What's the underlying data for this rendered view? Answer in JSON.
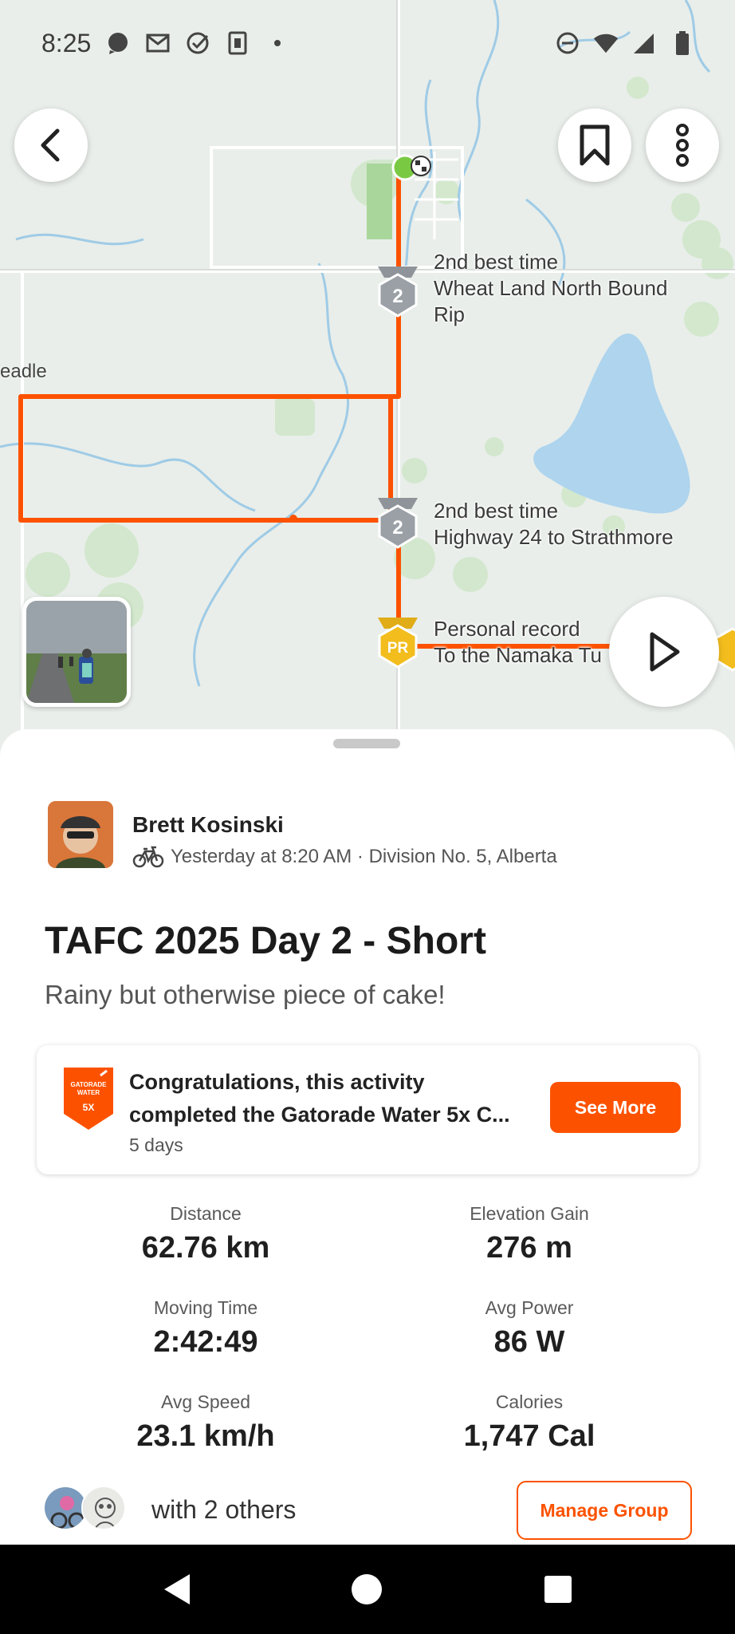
{
  "status_bar": {
    "time": "8:25",
    "icons_left": [
      "chat-bubble-icon",
      "mail-icon",
      "check-circle-icon",
      "notification-icon",
      "dot-icon"
    ],
    "icons_right": [
      "do-not-disturb-icon",
      "wifi-icon",
      "signal-icon",
      "battery-icon"
    ]
  },
  "map": {
    "place_label": "eadle",
    "segments": [
      {
        "achievement": "2nd best time",
        "name_line1": "Wheat Land North Bound",
        "name_line2": "Rip",
        "medal": "2"
      },
      {
        "achievement": "2nd best time",
        "name_line1": "Highway 24 to Strathmore",
        "name_line2": "",
        "medal": "2"
      },
      {
        "achievement": "Personal record",
        "name_line1": "To the Namaka Tu",
        "name_line2": "",
        "medal": "PR"
      }
    ],
    "colors": {
      "route": "#fc5200",
      "start": "#7ac943",
      "water": "#aed4ee",
      "field": "#c8e3c2"
    }
  },
  "athlete": {
    "name": "Brett Kosinski",
    "meta": "Yesterday at 8:20 AM · Division No. 5, Alberta",
    "sport_icon": "bike-icon"
  },
  "activity": {
    "title": "TAFC 2025 Day 2 - Short",
    "description": "Rainy but otherwise piece of cake!"
  },
  "challenge": {
    "line1": "Congratulations, this activity",
    "line2": "completed the Gatorade Water 5x C...",
    "sub": "5 days",
    "badge_text_top": "GATORADE",
    "badge_text_mid": "WATER",
    "badge_text_num": "5X",
    "button": "See More"
  },
  "stats": [
    {
      "label": "Distance",
      "value": "62.76 km"
    },
    {
      "label": "Elevation Gain",
      "value": "276 m"
    },
    {
      "label": "Moving Time",
      "value": "2:42:49"
    },
    {
      "label": "Avg Power",
      "value": "86 W"
    },
    {
      "label": "Avg Speed",
      "value": "23.1 km/h"
    },
    {
      "label": "Calories",
      "value": "1,747 Cal"
    }
  ],
  "group": {
    "text": "with 2 others",
    "button": "Manage Group"
  },
  "accent_color": "#fc5200"
}
